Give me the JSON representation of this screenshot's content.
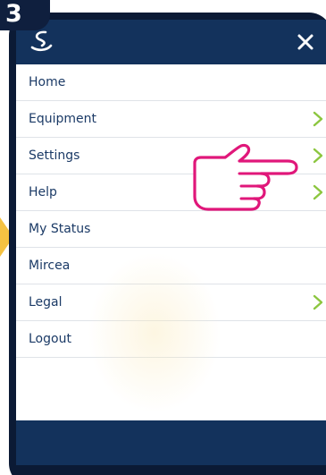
{
  "step": {
    "number": "3"
  },
  "header": {
    "logo_icon": "swirl-logo-icon",
    "close_icon": "close-icon"
  },
  "menu": {
    "items": [
      {
        "label": "Home",
        "has_chevron": false
      },
      {
        "label": "Equipment",
        "has_chevron": true
      },
      {
        "label": "Settings",
        "has_chevron": true
      },
      {
        "label": "Help",
        "has_chevron": true
      },
      {
        "label": "My Status",
        "has_chevron": false
      },
      {
        "label": "Mircea",
        "has_chevron": false
      },
      {
        "label": "Legal",
        "has_chevron": true
      },
      {
        "label": "Logout",
        "has_chevron": false
      }
    ]
  },
  "annotations": {
    "pointer_icon": "pointing-hand-icon",
    "pointer_target": "Settings"
  },
  "colors": {
    "header_bg": "#13325c",
    "frame": "#0b1a35",
    "menu_text": "#1b3a66",
    "chevron": "#8cc63f",
    "hand_outline": "#e0177a",
    "arrow": "#f5c242"
  }
}
